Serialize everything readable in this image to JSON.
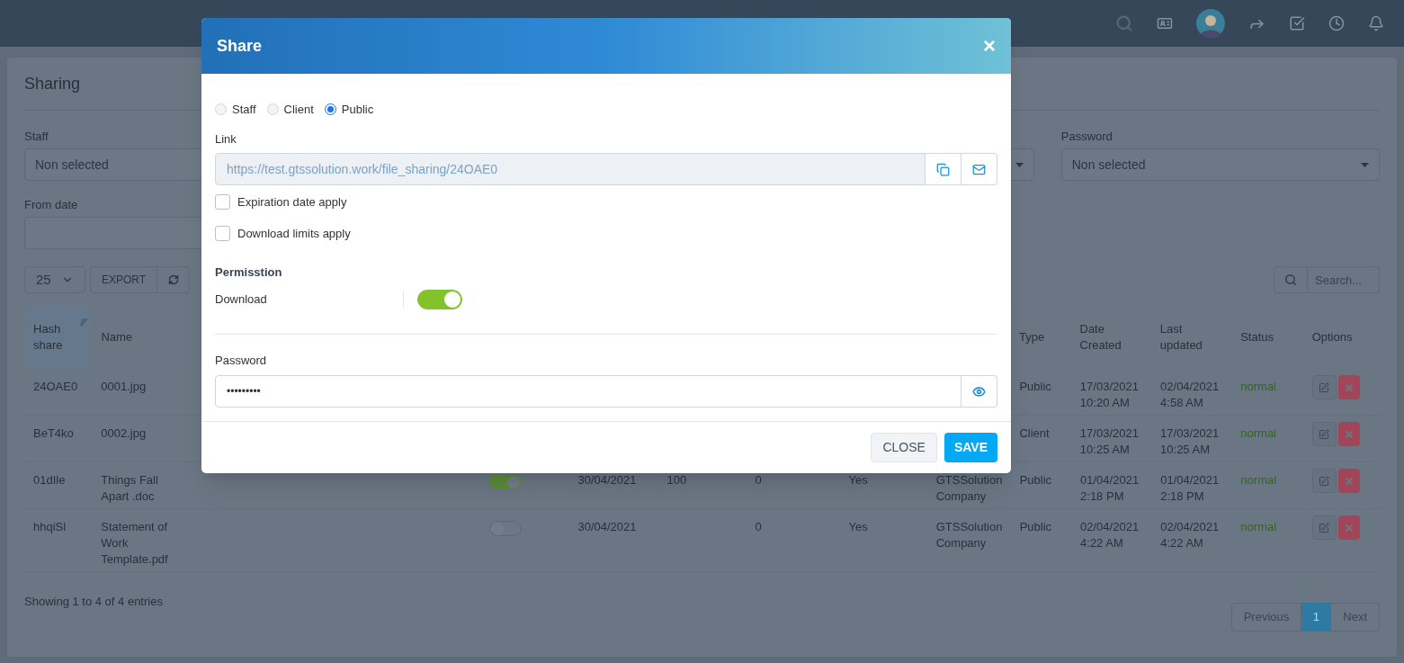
{
  "page": {
    "title": "Sharing",
    "filters_row_1": [
      {
        "kind": "select",
        "label": "Staff",
        "value": "Non selected"
      },
      {
        "kind": "covered"
      },
      {
        "kind": "select"
      },
      {
        "kind": "select",
        "label": "Password",
        "value": "Non selected"
      }
    ],
    "filters_row_2": [
      {
        "kind": "date",
        "label": "From date"
      }
    ]
  },
  "table_tools": {
    "page_length": "25",
    "export": "EXPORT",
    "search_placeholder": "Search..."
  },
  "table": {
    "header": {
      "hash": "Hash share",
      "hash_sorted": true,
      "name": "Name",
      "type": "Type",
      "date_created": "Date Created",
      "last_updated": "Last updated",
      "status": "Status",
      "options": "Options"
    },
    "rows": [
      {
        "hash": "24OAE0",
        "name": "0001.jpg",
        "type": "Public",
        "date_created": "17/03/2021 10:20 AM",
        "last_updated": "02/04/2021 4:58 AM",
        "status": "normal"
      },
      {
        "hash": "BeT4ko",
        "name": "0002.jpg",
        "type": "Client",
        "date_created": "17/03/2021 10:25 AM",
        "last_updated": "17/03/2021 10:25 AM",
        "status": "normal"
      },
      {
        "hash": "01dIle",
        "name": "Things Fall Apart .doc",
        "column_3": {
          "on": true
        },
        "column_4": "30/04/2021",
        "column_5": "100",
        "column_6": "0",
        "column_7": "Yes",
        "column_8": "GTSSolution Company",
        "type": "Public",
        "date_created": "01/04/2021 2:18 PM",
        "last_updated": "01/04/2021 2:18 PM",
        "status": "normal"
      },
      {
        "hash": "hhqiSl",
        "name": "Statement of Work Template.pdf",
        "column_3": {
          "on": false
        },
        "column_4": "30/04/2021",
        "column_6": "0",
        "column_7": "Yes",
        "column_8": "GTSSolution Company",
        "type": "Public",
        "date_created": "02/04/2021 4:22 AM",
        "last_updated": "02/04/2021 4:22 AM",
        "status": "normal"
      }
    ],
    "info": "Showing 1 to 4 of 4 entries"
  },
  "pagination": {
    "previous": "Previous",
    "pages": [
      {
        "label": "1",
        "selected": true
      }
    ],
    "next": "Next"
  },
  "modal": {
    "title": "Share",
    "close": "×",
    "audience": [
      {
        "label": "Staff",
        "selected": false
      },
      {
        "label": "Client",
        "selected": false
      },
      {
        "label": "Public",
        "selected": true
      }
    ],
    "link": {
      "label": "Link",
      "value": "https://test.gtssolution.work/file_sharing/24OAE0"
    },
    "options": [
      {
        "label": "Expiration date apply",
        "checked": false
      },
      {
        "label": "Download limits apply",
        "checked": false
      }
    ],
    "permission": {
      "heading": "Permisstion",
      "items": [
        {
          "label": "Download",
          "on": true
        }
      ]
    },
    "password": {
      "label": "Password",
      "value": "•••••••••"
    },
    "buttons": [
      {
        "kind": "secondary",
        "label": "CLOSE"
      },
      {
        "kind": "primary",
        "label": "SAVE"
      }
    ]
  }
}
